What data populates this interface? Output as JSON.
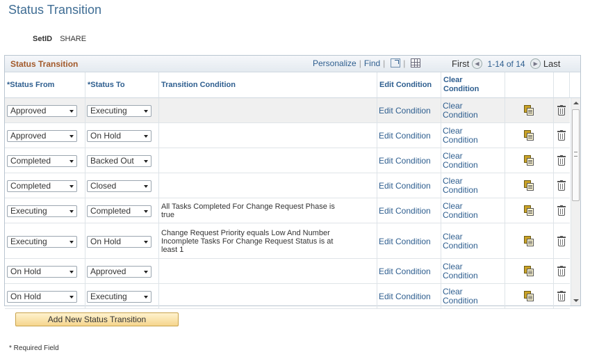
{
  "page": {
    "title": "Status Transition",
    "setid_label": "SetID",
    "setid_value": "SHARE"
  },
  "grid": {
    "title": "Status Transition",
    "nav": {
      "personalize": "Personalize",
      "find": "Find",
      "zoom_icon": "view-all-icon",
      "excel_icon": "download-excel-icon"
    },
    "pager": {
      "first": "First",
      "range": "1-14 of 14",
      "last": "Last"
    },
    "columns": {
      "status_from": "*Status From",
      "status_to": "*Status To",
      "transition_condition": "Transition Condition",
      "edit_condition": "Edit Condition",
      "clear_condition_line1": "Clear",
      "clear_condition_line2": "Condition"
    },
    "rows": [
      {
        "status_from": "Approved",
        "status_to": "Executing",
        "condition_line1": "",
        "condition_line2": "",
        "condition_line3": "",
        "edit": "Edit Condition",
        "clear1": "Clear",
        "clear2": "Condition"
      },
      {
        "status_from": "Approved",
        "status_to": "On Hold",
        "condition_line1": "",
        "condition_line2": "",
        "condition_line3": "",
        "edit": "Edit Condition",
        "clear1": "Clear",
        "clear2": "Condition"
      },
      {
        "status_from": "Completed",
        "status_to": "Backed Out",
        "condition_line1": "",
        "condition_line2": "",
        "condition_line3": "",
        "edit": "Edit Condition",
        "clear1": "Clear",
        "clear2": "Condition"
      },
      {
        "status_from": "Completed",
        "status_to": "Closed",
        "condition_line1": "",
        "condition_line2": "",
        "condition_line3": "",
        "edit": "Edit Condition",
        "clear1": "Clear",
        "clear2": "Condition"
      },
      {
        "status_from": "Executing",
        "status_to": "Completed",
        "condition_line1": "All Tasks Completed For Change Request Phase is",
        "condition_line2": "true",
        "condition_line3": "",
        "edit": "Edit Condition",
        "clear1": "Clear",
        "clear2": "Condition"
      },
      {
        "status_from": "Executing",
        "status_to": "On Hold",
        "condition_line1": "Change Request Priority equals Low And Number",
        "condition_line2": "Incomplete Tasks For Change Request Status is at",
        "condition_line3": "least 1",
        "edit": "Edit Condition",
        "clear1": "Clear",
        "clear2": "Condition"
      },
      {
        "status_from": "On Hold",
        "status_to": "Approved",
        "condition_line1": "",
        "condition_line2": "",
        "condition_line3": "",
        "edit": "Edit Condition",
        "clear1": "Clear",
        "clear2": "Condition"
      },
      {
        "status_from": "On Hold",
        "status_to": "Executing",
        "condition_line1": "",
        "condition_line2": "",
        "condition_line3": "",
        "edit": "Edit Condition",
        "clear1": "Clear",
        "clear2": "Condition"
      }
    ],
    "row_icons": {
      "copy": "copy-row-icon",
      "delete": "delete-row-icon"
    }
  },
  "add_button": "Add New Status Transition",
  "required_note": "* Required Field"
}
